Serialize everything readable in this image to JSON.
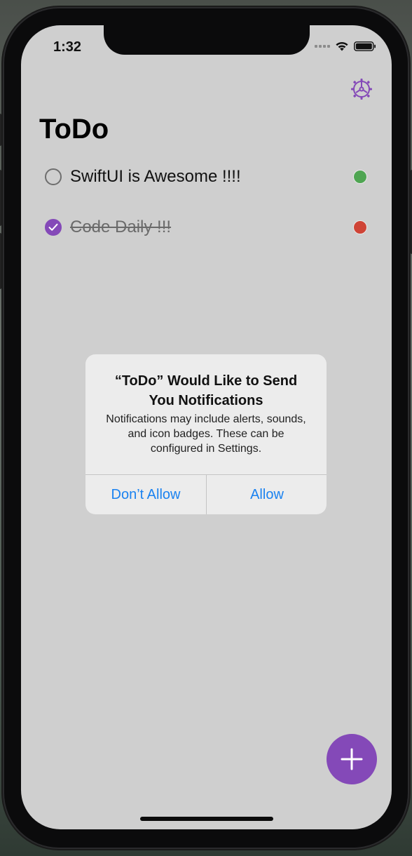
{
  "status_bar": {
    "time": "1:32"
  },
  "app": {
    "title": "ToDo",
    "accent_color": "#8449b8"
  },
  "todos": [
    {
      "label": "SwiftUI is Awesome !!!!",
      "completed": false,
      "priority_color": "#4fa552"
    },
    {
      "label": "Code Daily !!!",
      "completed": true,
      "priority_color": "#cf4436"
    }
  ],
  "alert": {
    "title": "“ToDo” Would Like to Send You Notifications",
    "message": "Notifications may include alerts, sounds, and icon badges. These can be configured in Settings.",
    "deny_label": "Don’t Allow",
    "allow_label": "Allow",
    "button_color": "#1a82f0"
  },
  "icons": {
    "settings": "gear-icon",
    "add": "plus-icon",
    "check": "checkmark-icon"
  }
}
